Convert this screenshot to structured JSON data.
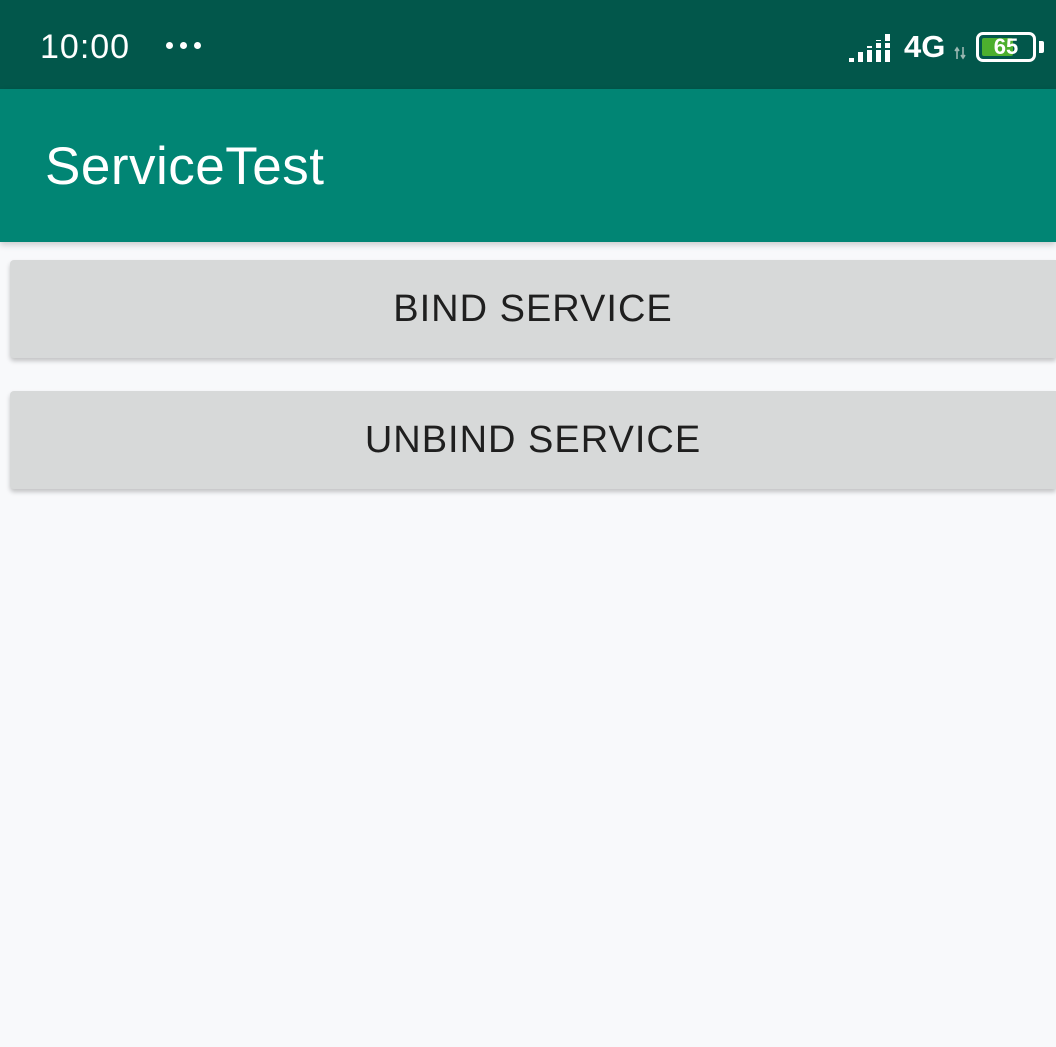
{
  "status_bar": {
    "time": "10:00",
    "network_type": "4G",
    "battery_level": "65",
    "battery_fraction": 0.65,
    "icons": [
      "more-dots-icon",
      "signal-icon",
      "network-arrows-icon",
      "battery-icon"
    ]
  },
  "app_bar": {
    "title": "ServiceTest"
  },
  "buttons": {
    "bind_label": "BIND SERVICE",
    "unbind_label": "UNBIND SERVICE"
  },
  "colors": {
    "status_bar": "#02574b",
    "app_bar": "#018574",
    "background": "#f8f9fb",
    "button": "#d7d9d9",
    "battery_fill": "#4caf2e"
  }
}
